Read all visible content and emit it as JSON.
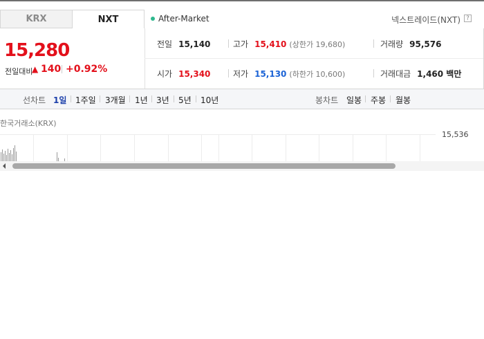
{
  "tabs": [
    {
      "label": "KRX"
    },
    {
      "label": "NXT"
    }
  ],
  "session": {
    "label": "After-Market",
    "status_color": "#2fb88e"
  },
  "market_label": "넥스트레이드(NXT)",
  "help_icon": "?",
  "quote": {
    "price": "15,280",
    "change_label": "전일대비",
    "change_arrow": "▲",
    "change_value": "140",
    "change_pct": "+0.92%",
    "up_color": "#e3101b",
    "down_color": "#1b63d6"
  },
  "stats": {
    "prev_close": {
      "label": "전일",
      "value": "15,140"
    },
    "high": {
      "label": "고가",
      "value": "15,410",
      "sub": "(상한가 19,680)"
    },
    "volume": {
      "label": "거래량",
      "value": "95,576"
    },
    "open": {
      "label": "시가",
      "value": "15,340"
    },
    "low": {
      "label": "저가",
      "value": "15,130",
      "sub": "(하한가 10,600)"
    },
    "turnover": {
      "label": "거래대금",
      "value": "1,460 백만"
    }
  },
  "line_chart": {
    "label": "선차트",
    "periods": [
      "1일",
      "1주일",
      "3개월",
      "1년",
      "3년",
      "5년",
      "10년"
    ],
    "selected": "1일"
  },
  "candle_chart": {
    "label": "봉차트",
    "periods": [
      "일봉",
      "주봉",
      "월봉"
    ]
  },
  "chart": {
    "exchange_label": "한국거래소(KRX)",
    "y_tick": "15,536"
  }
}
